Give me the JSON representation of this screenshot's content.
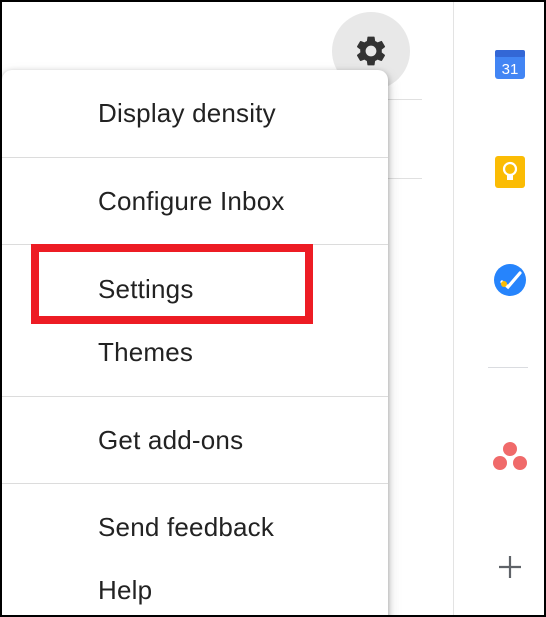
{
  "menu": {
    "items": [
      {
        "label": "Display density"
      },
      {
        "label": "Configure Inbox"
      },
      {
        "label": "Settings"
      },
      {
        "label": "Themes"
      },
      {
        "label": "Get add-ons"
      },
      {
        "label": "Send feedback"
      },
      {
        "label": "Help"
      }
    ]
  },
  "side_panel": {
    "calendar_day": "31",
    "icons": [
      "calendar-icon",
      "keep-icon",
      "tasks-icon",
      "asana-icon",
      "add-icon"
    ]
  },
  "colors": {
    "highlight": "#ed1c24",
    "calendar": "#4285f4",
    "keep": "#fbbc04",
    "tasks": "#2684fc",
    "asana": "#f06a6a"
  }
}
